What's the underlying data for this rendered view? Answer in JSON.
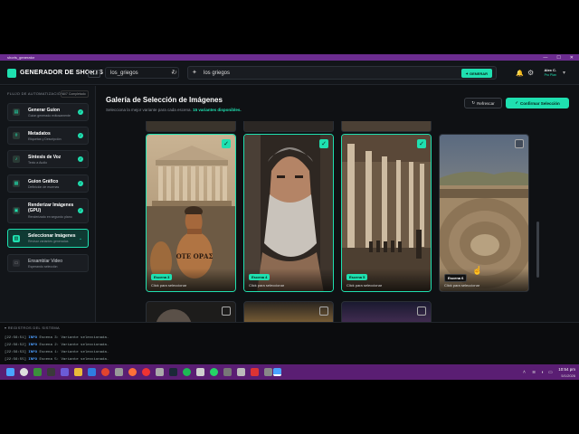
{
  "window": {
    "title": "shorts_generator",
    "controls": [
      "—",
      "☐",
      "✕"
    ]
  },
  "header": {
    "brand": "GENERADOR DE SHORTS",
    "version": "v1.0",
    "project": "los_griegos",
    "search_value": "los griegos",
    "generate_label": "GENERAR",
    "user_name": "Alex C.",
    "user_plan": "Pro Plan"
  },
  "sidebar": {
    "heading": "FLUJO DE AUTOMATIZACIÓN",
    "badge": "6/7 Completado",
    "steps": [
      {
        "title": "Generar Guion",
        "sub": "Guion generado exitosamente",
        "state": "done"
      },
      {
        "title": "Metadatos",
        "sub": "Etiquetas y Descripción",
        "state": "done"
      },
      {
        "title": "Síntesis de Voz",
        "sub": "Texto a Audio",
        "state": "done"
      },
      {
        "title": "Guion Gráfico",
        "sub": "Definición de escenas",
        "state": "done"
      },
      {
        "title": "Renderizar Imágenes (GPU)",
        "sub": "Renderizado en segundo plano",
        "state": "done"
      },
      {
        "title": "Seleccionar Imágenes",
        "sub": "Revisar variantes generadas",
        "state": "active"
      },
      {
        "title": "Ensamblar Video",
        "sub": "Esperando selección",
        "state": "pending"
      }
    ]
  },
  "gallery": {
    "title": "Galería de Selección de Imágenes",
    "subtitle": "Selecciona la mejor variante para cada escena.",
    "available": "15 variantes disponibles.",
    "refresh_label": "Refrescar",
    "confirm_label": "Confirmar Selección",
    "cards": [
      {
        "scene": "Escena 3",
        "caption": "Click para seleccionar",
        "selected": true
      },
      {
        "scene": "Escena 4",
        "caption": "Click para seleccionar",
        "selected": true
      },
      {
        "scene": "Escena 5",
        "caption": "Click para seleccionar",
        "selected": true
      },
      {
        "scene": "Escena 6",
        "caption": "Click para seleccionar",
        "selected": false
      }
    ],
    "vase_text": "ΟΤΕ ΟΡΑΣ"
  },
  "logs": {
    "heading": "REGISTROS DEL SISTEMA",
    "lines": [
      {
        "time": "[22:56:51]",
        "level": "INFO",
        "msg": "Escena 3: Variante seleccionada."
      },
      {
        "time": "[22:56:52]",
        "level": "INFO",
        "msg": "Escena 2: Variante seleccionada."
      },
      {
        "time": "[22:56:53]",
        "level": "INFO",
        "msg": "Escena 1: Variante seleccionada."
      },
      {
        "time": "[22:56:55]",
        "level": "INFO",
        "msg": "Escena 5: Variante seleccionada."
      }
    ]
  },
  "taskbar": {
    "time": "10:54 pm",
    "date": "5/1/2026"
  }
}
